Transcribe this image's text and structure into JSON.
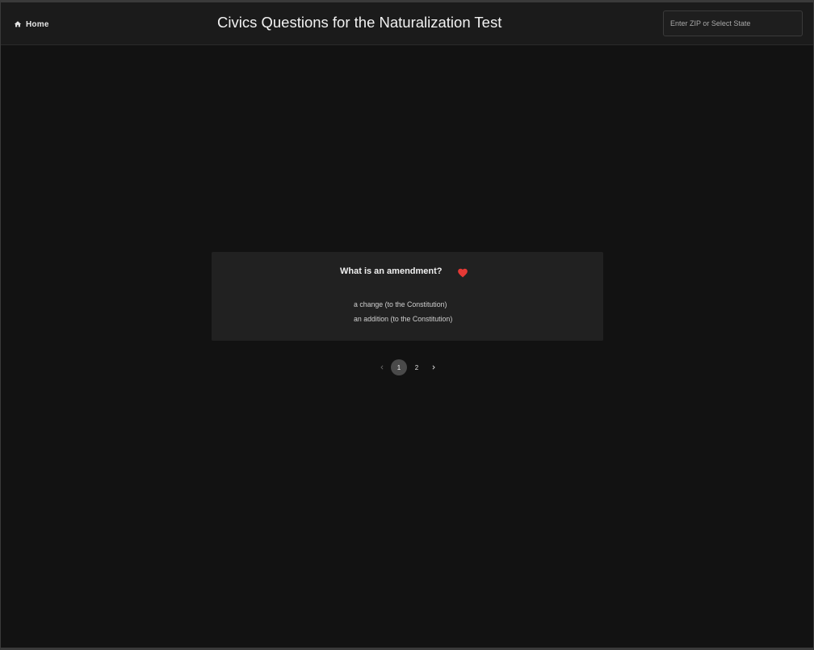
{
  "header": {
    "home_label": "Home",
    "title": "Civics Questions for the Naturalization Test",
    "zip_placeholder": "Enter ZIP or Select State",
    "zip_value": ""
  },
  "card": {
    "question": "What is an amendment?",
    "favorite_icon": "heart-icon",
    "favorite_color": "#e53935",
    "answers": [
      "a change (to the Constitution)",
      "an addition (to the Constitution)"
    ]
  },
  "pagination": {
    "pages": [
      "1",
      "2"
    ],
    "current_page": "1",
    "prev_icon": "chevron-left-icon",
    "next_icon": "chevron-right-icon"
  },
  "colors": {
    "background": "#121212",
    "header": "#1b1b1b",
    "card": "#212121",
    "active_page": "#4a4a4a"
  }
}
